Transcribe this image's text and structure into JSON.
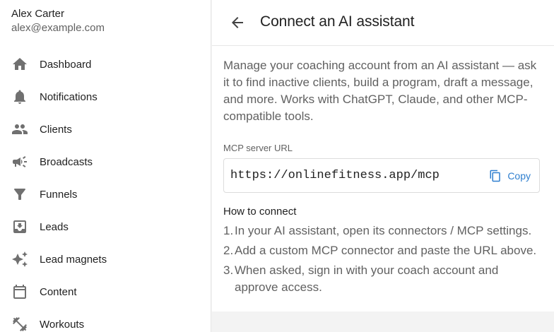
{
  "user": {
    "name": "Alex Carter",
    "email": "alex@example.com"
  },
  "sidebar": {
    "items": [
      {
        "label": "Dashboard",
        "icon": "home-icon"
      },
      {
        "label": "Notifications",
        "icon": "bell-icon"
      },
      {
        "label": "Clients",
        "icon": "people-icon"
      },
      {
        "label": "Broadcasts",
        "icon": "megaphone-icon"
      },
      {
        "label": "Funnels",
        "icon": "funnel-icon"
      },
      {
        "label": "Leads",
        "icon": "inbox-download-icon"
      },
      {
        "label": "Lead magnets",
        "icon": "sparkles-icon"
      },
      {
        "label": "Content",
        "icon": "calendar-icon"
      },
      {
        "label": "Workouts",
        "icon": "dumbbell-icon"
      }
    ]
  },
  "panel": {
    "title": "Connect an AI assistant",
    "description": "Manage your coaching account from an AI assistant — ask it to find inactive clients, build a program, draft a message, and more. Works with ChatGPT, Claude, and other MCP-compatible tools.",
    "url_field": {
      "label": "MCP server URL",
      "value": "https://onlinefitness.app/mcp",
      "copy_label": "Copy"
    },
    "how_to": {
      "title": "How to connect",
      "steps": [
        {
          "num": "1.",
          "text": "In your AI assistant, open its connectors / MCP settings."
        },
        {
          "num": "2.",
          "text": "Add a custom MCP connector and paste the URL above."
        },
        {
          "num": "3.",
          "text": "When asked, sign in with your coach account and approve access."
        }
      ]
    }
  },
  "colors": {
    "accent": "#2f7fcf",
    "icon_gray": "#707070",
    "muted_text": "#616161",
    "page_background": "#f3f3f3"
  }
}
